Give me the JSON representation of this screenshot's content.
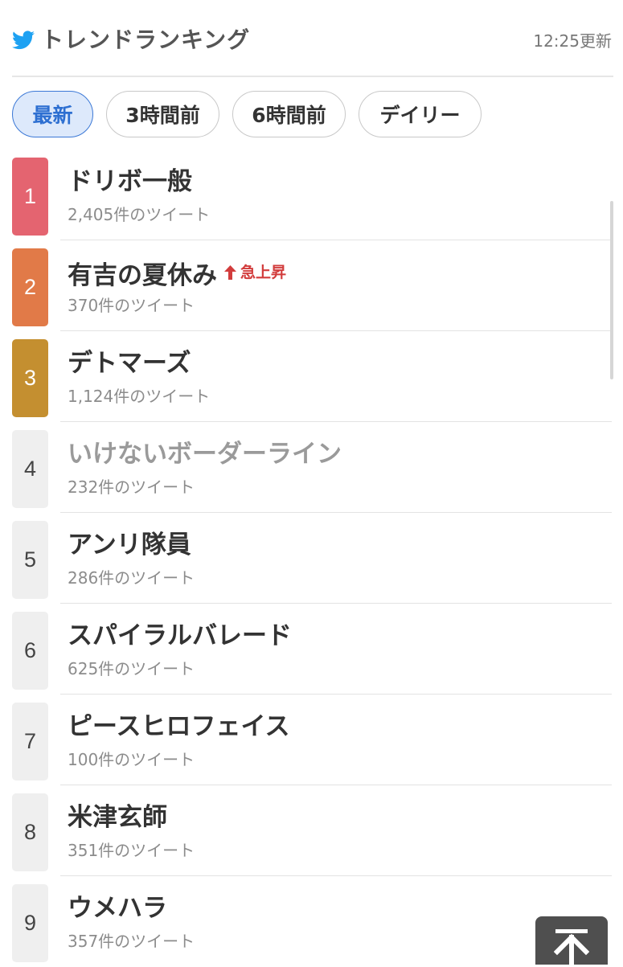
{
  "header": {
    "title": "トレンドランキング",
    "updated": "12:25更新",
    "icon": "twitter-bird-icon",
    "icon_color": "#1da1f2"
  },
  "tabs": [
    {
      "label": "最新",
      "active": true
    },
    {
      "label": "3時間前",
      "active": false
    },
    {
      "label": "6時間前",
      "active": false
    },
    {
      "label": "デイリー",
      "active": false
    }
  ],
  "colors": {
    "rank1": "#e46470",
    "rank2": "#e17a48",
    "rank3": "#c48f30",
    "surge": "#d23c3c",
    "active_tab_border": "#3b78d6"
  },
  "trends": [
    {
      "rank": "1",
      "name": "ドリボ一般",
      "count": "2,405件のツイート"
    },
    {
      "rank": "2",
      "name": "有吉の夏休み",
      "badge": "急上昇",
      "count": "370件のツイート"
    },
    {
      "rank": "3",
      "name": "デトマーズ",
      "count": "1,124件のツイート"
    },
    {
      "rank": "4",
      "name": "いけないボーダーライン",
      "count": "232件のツイート",
      "visited": true
    },
    {
      "rank": "5",
      "name": "アンリ隊員",
      "count": "286件のツイート"
    },
    {
      "rank": "6",
      "name": "スパイラルバレード",
      "count": "625件のツイート"
    },
    {
      "rank": "7",
      "name": "ピースヒロフェイス",
      "count": "100件のツイート"
    },
    {
      "rank": "8",
      "name": "米津玄師",
      "count": "351件のツイート"
    },
    {
      "rank": "9",
      "name": "ウメハラ",
      "count": "357件のツイート"
    }
  ]
}
